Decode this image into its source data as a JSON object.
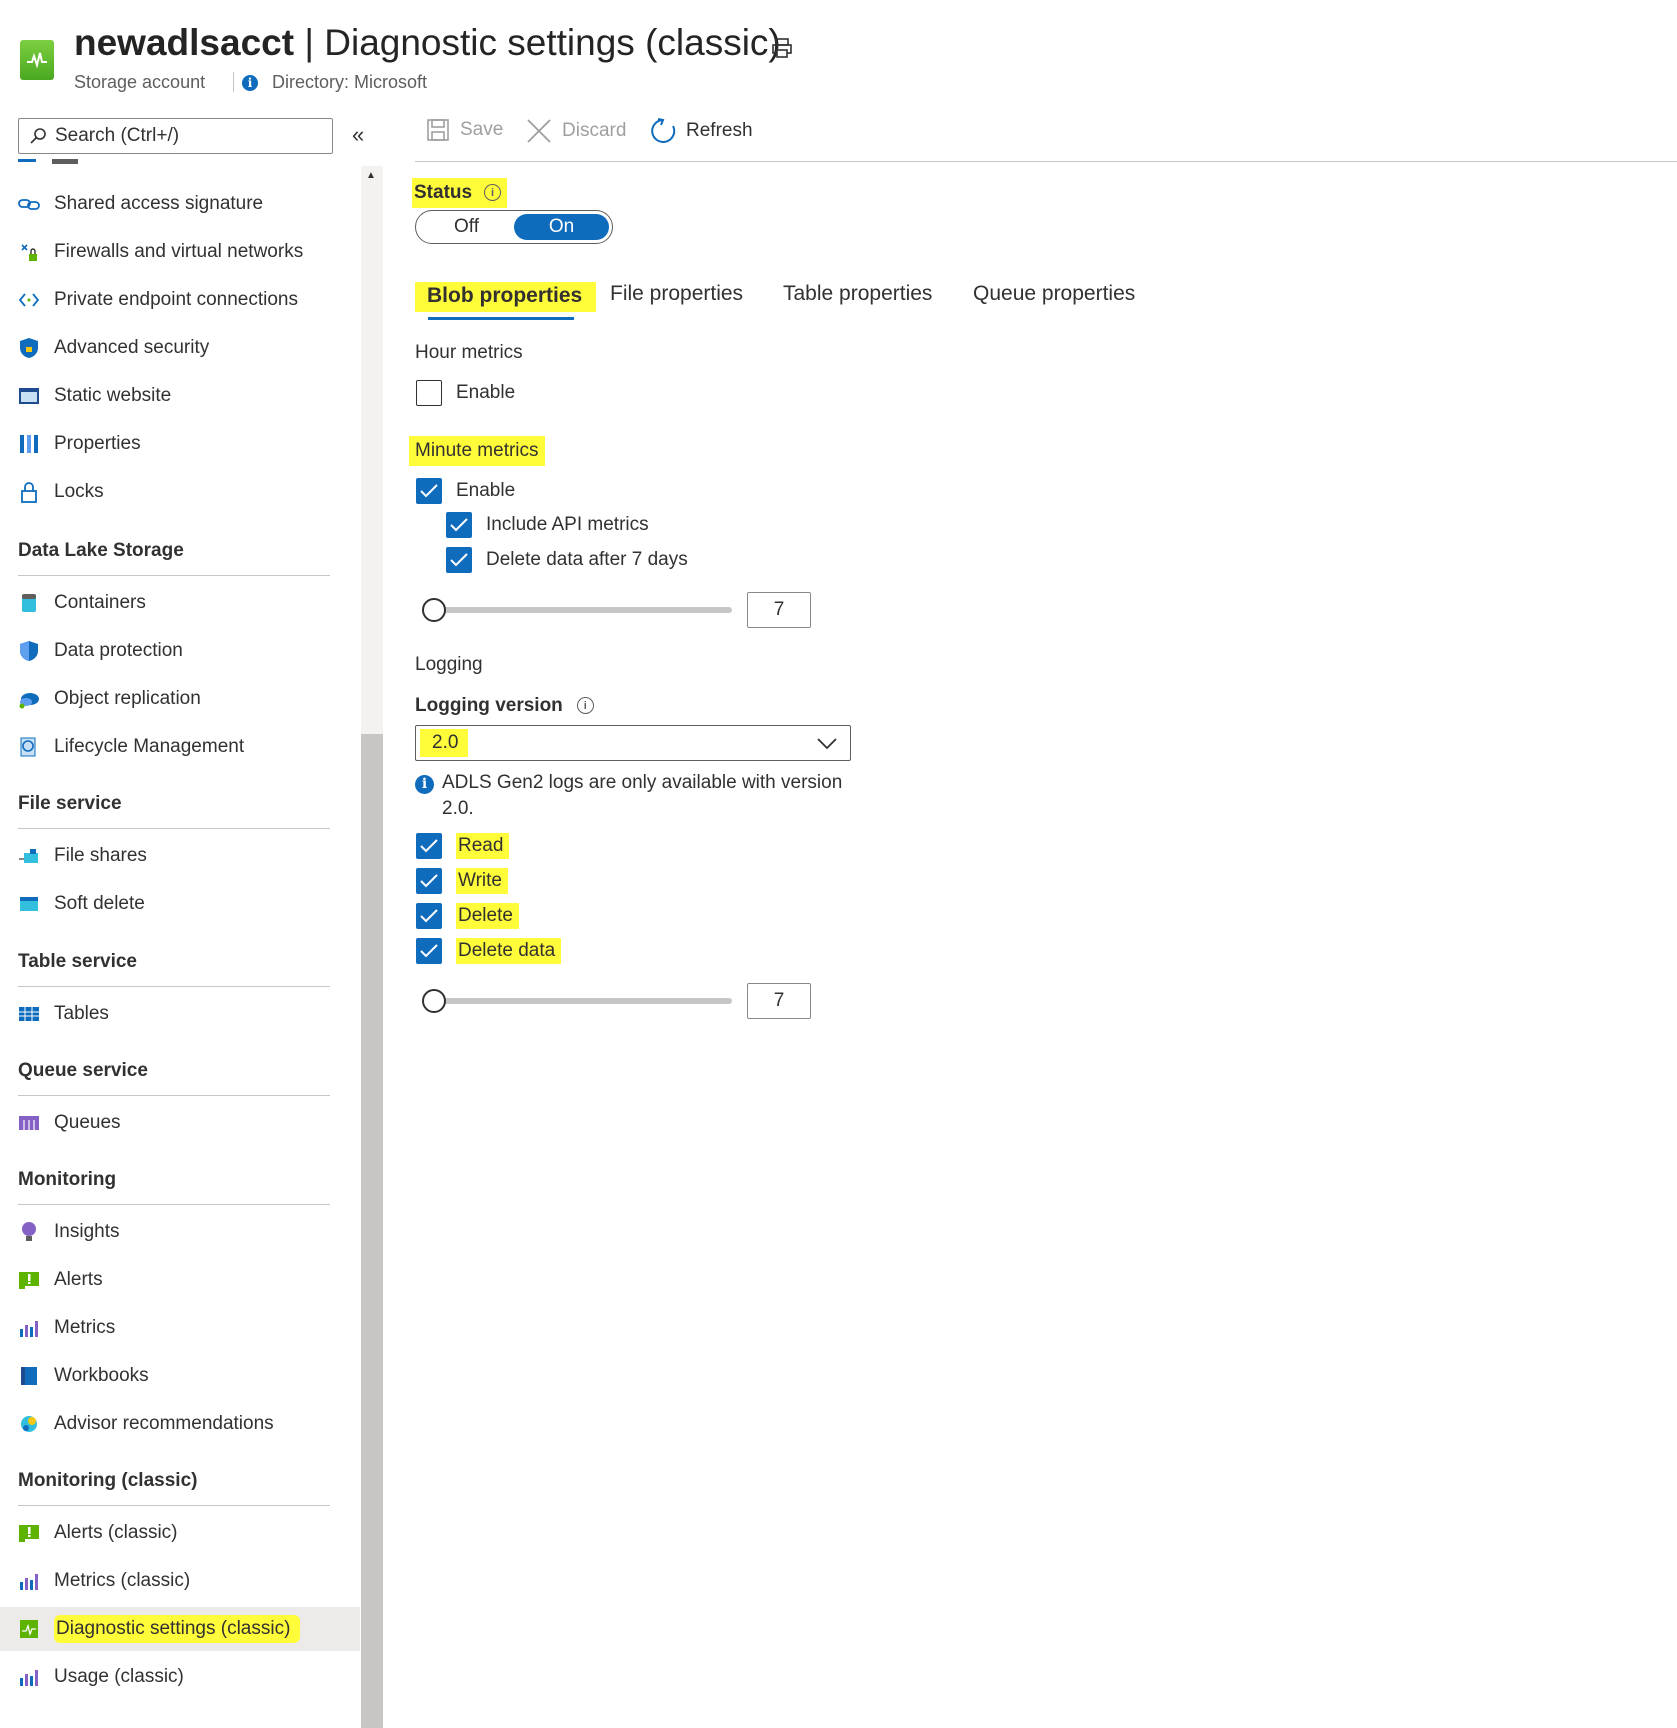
{
  "header": {
    "resource_name": "newadlsacct",
    "separator": "|",
    "page_title": "Diagnostic settings (classic)",
    "resource_type": "Storage account",
    "directory": "Directory: Microsoft"
  },
  "sidebar": {
    "search_placeholder": "Search (Ctrl+/)",
    "top_items": [
      {
        "label": "Shared access signature",
        "icon": "link-icon"
      },
      {
        "label": "Firewalls and virtual networks",
        "icon": "firewall-icon"
      },
      {
        "label": "Private endpoint connections",
        "icon": "private-endpoint-icon"
      },
      {
        "label": "Advanced security",
        "icon": "shield-lock-icon"
      },
      {
        "label": "Static website",
        "icon": "website-icon"
      },
      {
        "label": "Properties",
        "icon": "properties-icon"
      },
      {
        "label": "Locks",
        "icon": "lock-icon"
      }
    ],
    "sections": [
      {
        "title": "Data Lake Storage",
        "items": [
          {
            "label": "Containers",
            "icon": "container-icon"
          },
          {
            "label": "Data protection",
            "icon": "shield-icon"
          },
          {
            "label": "Object replication",
            "icon": "cloud-replication-icon"
          },
          {
            "label": "Lifecycle Management",
            "icon": "lifecycle-icon"
          }
        ]
      },
      {
        "title": "File service",
        "items": [
          {
            "label": "File shares",
            "icon": "file-share-icon"
          },
          {
            "label": "Soft delete",
            "icon": "soft-delete-icon"
          }
        ]
      },
      {
        "title": "Table service",
        "items": [
          {
            "label": "Tables",
            "icon": "table-icon"
          }
        ]
      },
      {
        "title": "Queue service",
        "items": [
          {
            "label": "Queues",
            "icon": "queue-icon"
          }
        ]
      },
      {
        "title": "Monitoring",
        "items": [
          {
            "label": "Insights",
            "icon": "lightbulb-icon"
          },
          {
            "label": "Alerts",
            "icon": "alert-icon"
          },
          {
            "label": "Metrics",
            "icon": "metrics-icon"
          },
          {
            "label": "Workbooks",
            "icon": "workbook-icon"
          },
          {
            "label": "Advisor recommendations",
            "icon": "advisor-icon"
          }
        ]
      },
      {
        "title": "Monitoring (classic)",
        "items": [
          {
            "label": "Alerts (classic)",
            "icon": "alert-icon"
          },
          {
            "label": "Metrics (classic)",
            "icon": "metrics-icon"
          },
          {
            "label": "Diagnostic settings (classic)",
            "icon": "diagnostic-icon",
            "active": true
          },
          {
            "label": "Usage (classic)",
            "icon": "metrics-icon"
          }
        ]
      }
    ]
  },
  "toolbar": {
    "save_label": "Save",
    "discard_label": "Discard",
    "refresh_label": "Refresh"
  },
  "main": {
    "status_label": "Status",
    "toggle_off": "Off",
    "toggle_on": "On",
    "toggle_value": "On",
    "tabs": [
      "Blob properties",
      "File properties",
      "Table properties",
      "Queue properties"
    ],
    "active_tab": "Blob properties",
    "hour_metrics": {
      "title": "Hour metrics",
      "enable_label": "Enable",
      "enable_checked": false
    },
    "minute_metrics": {
      "title": "Minute metrics",
      "enable_label": "Enable",
      "enable_checked": true,
      "include_api_label": "Include API metrics",
      "include_api_checked": true,
      "delete_after_label": "Delete data after 7 days",
      "delete_after_checked": true,
      "retention_days": "7",
      "retention_slider_fraction": 0.0
    },
    "logging": {
      "title": "Logging",
      "version_label": "Logging version",
      "version_value": "2.0",
      "note": "ADLS Gen2 logs are only available with version 2.0.",
      "read_label": "Read",
      "read_checked": true,
      "write_label": "Write",
      "write_checked": true,
      "delete_label": "Delete",
      "delete_checked": true,
      "delete_data_label": "Delete data",
      "delete_data_checked": true,
      "retention_days": "7",
      "retention_slider_fraction": 0.0
    }
  },
  "colors": {
    "accent": "#0f6cbd",
    "highlight": "#fffc3a",
    "text": "#323130",
    "disabled_text": "#a19f9d"
  }
}
